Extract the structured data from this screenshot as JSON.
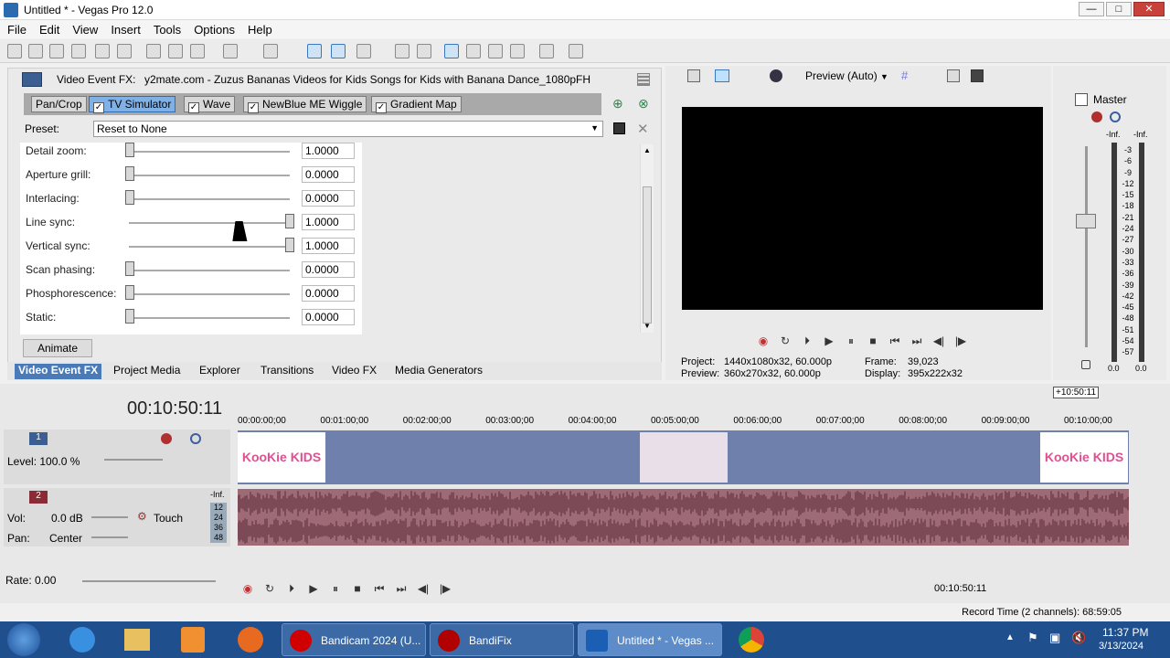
{
  "window": {
    "title": "Untitled * - Vegas Pro 12.0",
    "minimize": "—",
    "maximize": "□",
    "close": "✕"
  },
  "menu": [
    "File",
    "Edit",
    "View",
    "Insert",
    "Tools",
    "Options",
    "Help"
  ],
  "fx": {
    "header_label": "Video Event FX:",
    "header_file": "y2mate.com - Zuzus Bananas  Videos for Kids  Songs for Kids with Banana Dance_1080pFH",
    "chain": [
      {
        "label": "Pan/Crop",
        "checkbox": false,
        "selected": false
      },
      {
        "label": "TV Simulator",
        "checkbox": true,
        "selected": true
      },
      {
        "label": "Wave",
        "checkbox": true,
        "selected": false
      },
      {
        "label": "NewBlue ME Wiggle",
        "checkbox": true,
        "selected": false
      },
      {
        "label": "Gradient Map",
        "checkbox": true,
        "selected": false
      }
    ],
    "preset_label": "Preset:",
    "preset_value": "Reset to None",
    "params": [
      {
        "label": "Detail zoom:",
        "value": "1.0000",
        "level": 0
      },
      {
        "label": "Aperture grill:",
        "value": "0.0000",
        "level": 0
      },
      {
        "label": "Interlacing:",
        "value": "0.0000",
        "level": 0
      },
      {
        "label": "Line sync:",
        "value": "1.0000",
        "level": 1
      },
      {
        "label": "Vertical sync:",
        "value": "1.0000",
        "level": 1
      },
      {
        "label": "Scan phasing:",
        "value": "0.0000",
        "level": 0
      },
      {
        "label": "Phosphorescence:",
        "value": "0.0000",
        "level": 0
      },
      {
        "label": "Static:",
        "value": "0.0000",
        "level": 0
      }
    ],
    "animate_label": "Animate"
  },
  "tabs": [
    "Video Event FX",
    "Project Media",
    "Explorer",
    "Transitions",
    "Video FX",
    "Media Generators"
  ],
  "preview": {
    "mode": "Preview (Auto)",
    "project_label": "Project:",
    "project_value": "1440x1080x32, 60.000p",
    "preview_label": "Preview:",
    "preview_value": "360x270x32, 60.000p",
    "frame_label": "Frame:",
    "frame_value": "39,023",
    "display_label": "Display:",
    "display_value": "395x222x32"
  },
  "master": {
    "label": "Master",
    "inf_left": "-Inf.",
    "inf_right": "-Inf.",
    "scale": [
      "3",
      "6",
      "9",
      "12",
      "15",
      "18",
      "21",
      "24",
      "27",
      "30",
      "33",
      "36",
      "39",
      "42",
      "45",
      "48",
      "51",
      "54",
      "57"
    ],
    "bottom_left": "0.0",
    "bottom_right": "0.0"
  },
  "timeline": {
    "time": "00:10:50:11",
    "end_marker": "+10:50:11",
    "ruler": [
      "00:00:00;00",
      "00:01:00;00",
      "00:02:00;00",
      "00:03:00;00",
      "00:04:00;00",
      "00:05:00;00",
      "00:06:00;00",
      "00:07:00;00",
      "00:08:00;00",
      "00:09:00;00",
      "00:10:00;00"
    ],
    "track1": {
      "number": "1",
      "level": "Level: 100.0 %"
    },
    "track2": {
      "number": "2",
      "vol_label": "Vol:",
      "vol_value": "0.0 dB",
      "pan_label": "Pan:",
      "pan_value": "Center",
      "automation": "Touch",
      "meter_top": "-Inf.",
      "meter_scale": [
        "12",
        "24",
        "36",
        "48"
      ]
    },
    "clip_logo": "KooKie KIDS",
    "rate": "Rate: 0.00",
    "bottom_time": "00:10:50:11"
  },
  "status": {
    "record_time": "Record Time (2 channels): 68:59:05"
  },
  "taskbar": {
    "items": [
      {
        "label": "Bandicam 2024 (U...",
        "color": "#d00000"
      },
      {
        "label": "BandiFix",
        "color": "#b00000"
      },
      {
        "label": "Untitled * - Vegas ...",
        "color": "#1a5fb4"
      }
    ],
    "time": "11:37 PM",
    "date": "3/13/2024"
  }
}
